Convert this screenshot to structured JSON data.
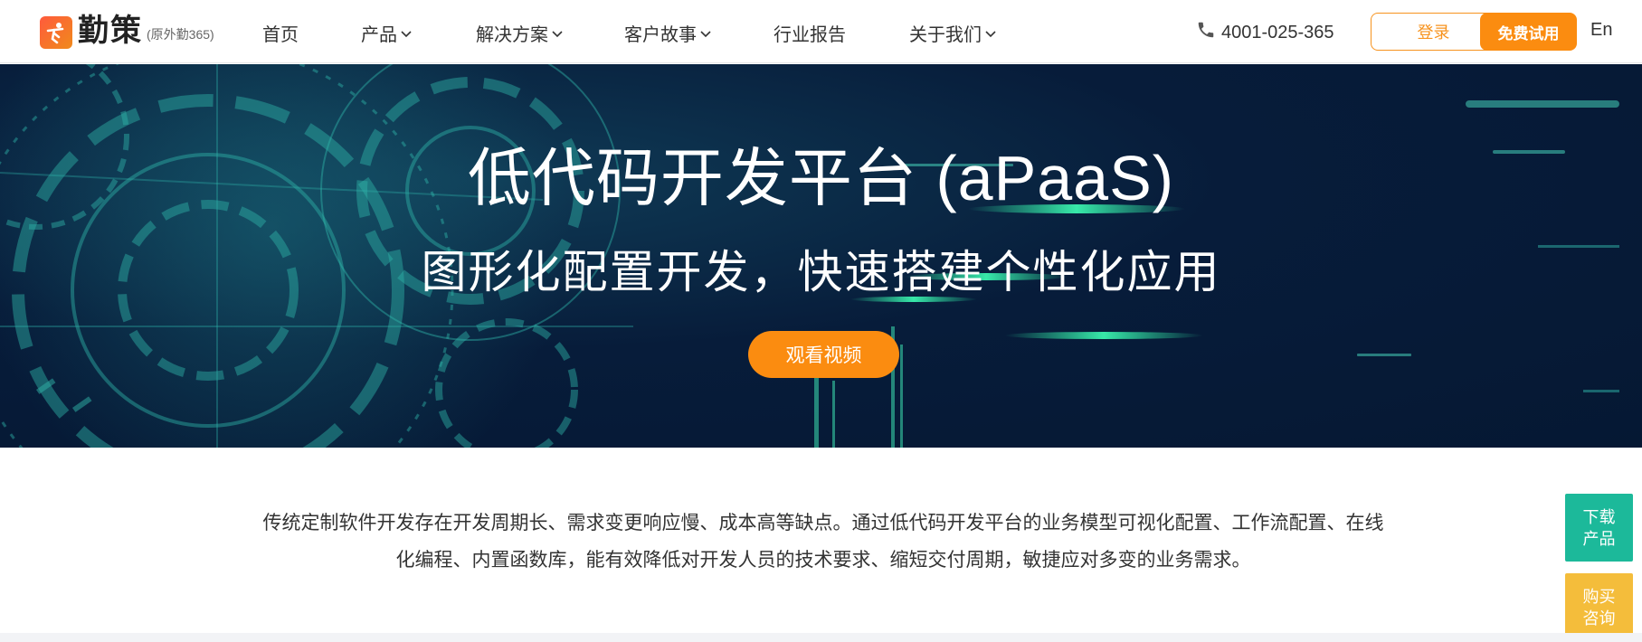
{
  "header": {
    "logo_text": "勤策",
    "logo_sub": "(原外勤365)",
    "nav": [
      {
        "label": "首页",
        "has_dropdown": false
      },
      {
        "label": "产品",
        "has_dropdown": true
      },
      {
        "label": "解决方案",
        "has_dropdown": true
      },
      {
        "label": "客户故事",
        "has_dropdown": true
      },
      {
        "label": "行业报告",
        "has_dropdown": false
      },
      {
        "label": "关于我们",
        "has_dropdown": true
      }
    ],
    "phone": "4001-025-365",
    "login_label": "登录",
    "trial_label": "免费试用",
    "lang_label": "En"
  },
  "hero": {
    "title": "低代码开发平台 (aPaaS)",
    "subtitle": "图形化配置开发，快速搭建个性化应用",
    "video_button": "观看视频"
  },
  "description": "传统定制软件开发存在开发周期长、需求变更响应慢、成本高等缺点。通过低代码开发平台的业务模型可视化配置、工作流配置、在线化编程、内置函数库，能有效降低对开发人员的技术要求、缩短交付周期，敏捷应对多变的业务需求。",
  "side": {
    "download_label": "下载产品",
    "consult_label": "购买咨询"
  },
  "colors": {
    "accent_orange": "#fb8c10",
    "hero_bg": "#071c3a",
    "side_green": "#1cb99a",
    "side_yellow": "#f4bd3b"
  },
  "icons": [
    "logo-mark-icon",
    "chevron-down-icon",
    "phone-icon"
  ]
}
